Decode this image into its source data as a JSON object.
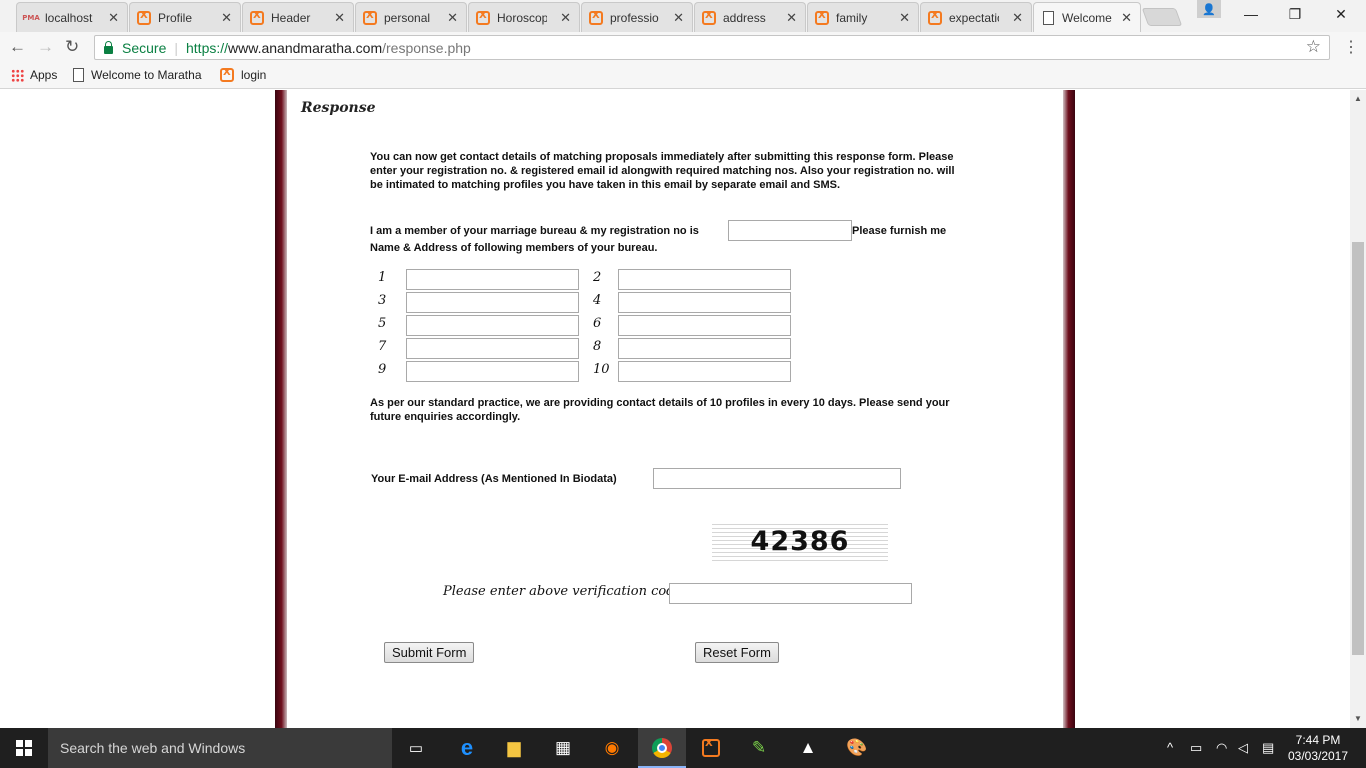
{
  "browser": {
    "tabs": [
      {
        "title": "localhost",
        "icon": "phpmyadmin-icon"
      },
      {
        "title": "Profile",
        "icon": "xampp-icon"
      },
      {
        "title": "Header",
        "icon": "xampp-icon"
      },
      {
        "title": "personal",
        "icon": "xampp-icon"
      },
      {
        "title": "Horoscop",
        "icon": "xampp-icon"
      },
      {
        "title": "professio",
        "icon": "xampp-icon"
      },
      {
        "title": "address",
        "icon": "xampp-icon"
      },
      {
        "title": "family",
        "icon": "xampp-icon"
      },
      {
        "title": "expectatio",
        "icon": "xampp-icon"
      },
      {
        "title": "Welcome",
        "icon": "document-icon"
      }
    ],
    "favicon_pma": "PMA",
    "secure_label": "Secure",
    "url_scheme": "https://",
    "url_host": "www.anandmaratha.com",
    "url_path": "/response.php",
    "bookmarks": {
      "apps": "Apps",
      "welcome": "Welcome to Maratha",
      "login": "login"
    }
  },
  "page": {
    "heading": "Response",
    "intro": "You can now get contact details of matching proposals immediately after submitting this response form. Please enter your registration no. & registered email id alongwith required matching nos. Also your registration no. will be intimated to matching profiles you have taken in this email by separate email and SMS.",
    "member_text_a": "I am a member of your marriage bureau & my registration no is",
    "member_text_b": "Please furnish me",
    "member_text_c": "Name & Address of following members of your bureau.",
    "registration_value": "",
    "members": [
      {
        "num": "1",
        "value": ""
      },
      {
        "num": "2",
        "value": ""
      },
      {
        "num": "3",
        "value": ""
      },
      {
        "num": "4",
        "value": ""
      },
      {
        "num": "5",
        "value": ""
      },
      {
        "num": "6",
        "value": ""
      },
      {
        "num": "7",
        "value": ""
      },
      {
        "num": "8",
        "value": ""
      },
      {
        "num": "9",
        "value": ""
      },
      {
        "num": "10",
        "value": ""
      }
    ],
    "practice_note": "As per our standard practice, we are providing contact details of 10 profiles in every 10 days. Please send your future enquiries accordingly.",
    "email_label": "Your E-mail Address (As Mentioned In Biodata)",
    "email_value": "",
    "captcha_code": "42386",
    "verify_label": "Please enter above verification code",
    "verify_value": "",
    "submit_label": "Submit Form",
    "reset_label": "Reset Form"
  },
  "taskbar": {
    "search_placeholder": "Search the web and Windows",
    "time": "7:44 PM",
    "date": "03/03/2017"
  },
  "colors": {
    "secure_green": "#0b8043",
    "frame_maroon": "#6e0f1d",
    "xampp_orange": "#f47a20",
    "taskbar": "#1f1f1f"
  }
}
